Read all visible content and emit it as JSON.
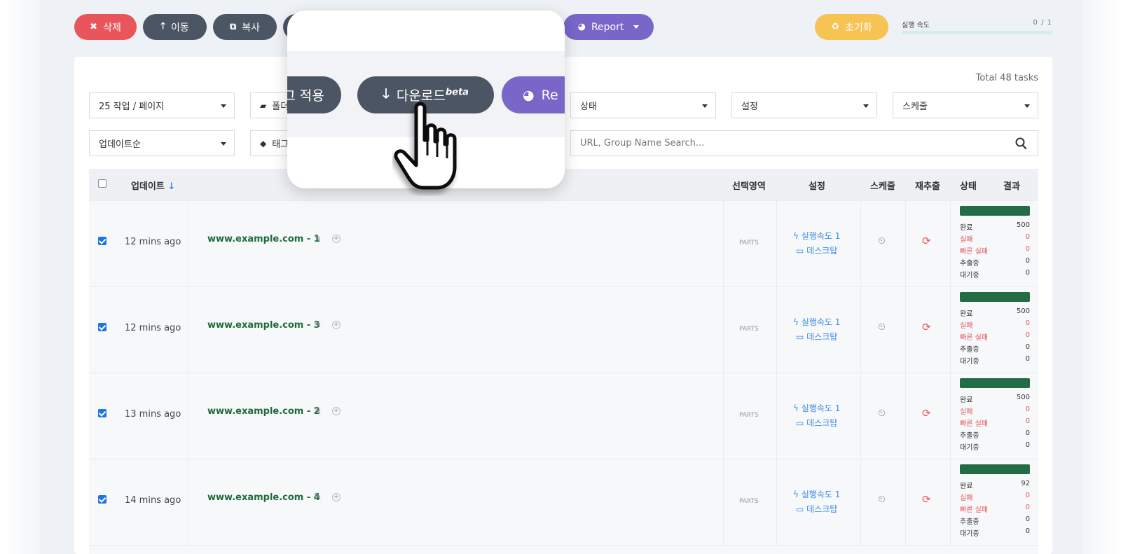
{
  "toolbar": {
    "delete_label": "삭제",
    "move_label": "이동",
    "copy_label": "복사",
    "report_label": "Report",
    "reset_label": "초기화",
    "speed_label": "실행 속도",
    "speed_count": "0 / 1",
    "speed_progress": 0
  },
  "popup": {
    "tag_apply_label": "그 적용",
    "download_label": "다운로드",
    "download_badge": "beta",
    "report_label": "Re"
  },
  "filters": {
    "per_page": "25 작업 / 페이지",
    "folder": "폴더",
    "status": "상태",
    "settings": "설정",
    "schedule": "스케줄",
    "sort": "업데이트순",
    "tag": "태그",
    "search_placeholder": "URL, Group Name Search..."
  },
  "total_text": "Total  48 tasks",
  "table": {
    "headers": {
      "update": "업데이트",
      "selection": "선택영역",
      "settings": "설정",
      "schedule": "스케줄",
      "reextract": "재추출",
      "status": "상태",
      "result": "결과"
    },
    "rows": [
      {
        "time": "12 mins ago",
        "url": "www.example.com - 1",
        "parts": "PARTS",
        "speed": "실행속도  1",
        "device": "데스크탑",
        "stats": {
          "done_label": "완료",
          "done": "500",
          "fail_label": "실패",
          "fail": "0",
          "fastfail_label": "빠른 실패",
          "fastfail": "0",
          "extracting_label": "추출중",
          "extracting": "0",
          "waiting_label": "대기중",
          "waiting": "0"
        }
      },
      {
        "time": "12 mins ago",
        "url": "www.example.com - 3",
        "parts": "PARTS",
        "speed": "실행속도  1",
        "device": "데스크탑",
        "stats": {
          "done_label": "완료",
          "done": "500",
          "fail_label": "실패",
          "fail": "0",
          "fastfail_label": "빠른 실패",
          "fastfail": "0",
          "extracting_label": "추출중",
          "extracting": "0",
          "waiting_label": "대기중",
          "waiting": "0"
        }
      },
      {
        "time": "13 mins ago",
        "url": "www.example.com - 2",
        "parts": "PARTS",
        "speed": "실행속도  1",
        "device": "데스크탑",
        "stats": {
          "done_label": "완료",
          "done": "500",
          "fail_label": "실패",
          "fail": "0",
          "fastfail_label": "빠른 실패",
          "fastfail": "0",
          "extracting_label": "추출중",
          "extracting": "0",
          "waiting_label": "대기중",
          "waiting": "0"
        }
      },
      {
        "time": "14 mins ago",
        "url": "www.example.com - 4",
        "parts": "PARTS",
        "speed": "실행속도  1",
        "device": "데스크탑",
        "stats": {
          "done_label": "완료",
          "done": "92",
          "fail_label": "실패",
          "fail": "0",
          "fastfail_label": "빠른 실패",
          "fastfail": "0",
          "extracting_label": "추출중",
          "extracting": "0",
          "waiting_label": "대기중",
          "waiting": "0"
        }
      }
    ]
  },
  "colors": {
    "danger": "#e8555a",
    "dark": "#4b5563",
    "purple": "#7866c9",
    "warning": "#f6c453",
    "success_bar": "#236c45",
    "link_green": "#1f6b3b",
    "info_blue": "#3d8be0"
  },
  "icons": [
    "close-icon",
    "arrow-up-icon",
    "copy-icon",
    "pie-chart-icon",
    "recycle-icon",
    "folder-icon",
    "tag-icon",
    "search-icon",
    "sort-down-icon",
    "edit-icon",
    "plus-circle-icon",
    "bolt-icon",
    "desktop-icon",
    "timer-icon",
    "refresh-icon",
    "arrow-down-icon",
    "hand-pointer-icon"
  ]
}
